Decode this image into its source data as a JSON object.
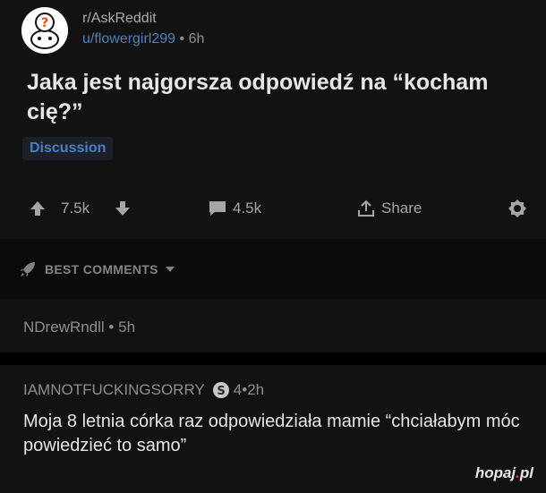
{
  "post": {
    "subreddit": "r/AskReddit",
    "author": "u/flowergirl299",
    "age": "6h",
    "title": "Jaka jest najgorsza odpowiedź na “kocham cię?”",
    "flair": "Discussion",
    "upvotes": "7.5k",
    "comments": "4.5k",
    "share_label": "Share"
  },
  "sort": {
    "label": "BEST COMMENTS"
  },
  "comments": [
    {
      "author": "NDrewRndll",
      "age": "5h"
    },
    {
      "author": "IAMNOTFUCKINGSORRY",
      "award_count": "4",
      "age": "2h",
      "body": "Moja 8 letnia córka raz odpowiedziała mamie “chciałabym móc powiedzieć to samo”"
    }
  ],
  "watermark": {
    "name": "hopaj",
    "dot": ".",
    "tld": "pl"
  },
  "colors": {
    "background": "#121213",
    "accent": "#4b83b8",
    "flair": "#4a7fc7",
    "muted": "#8c8e90"
  }
}
